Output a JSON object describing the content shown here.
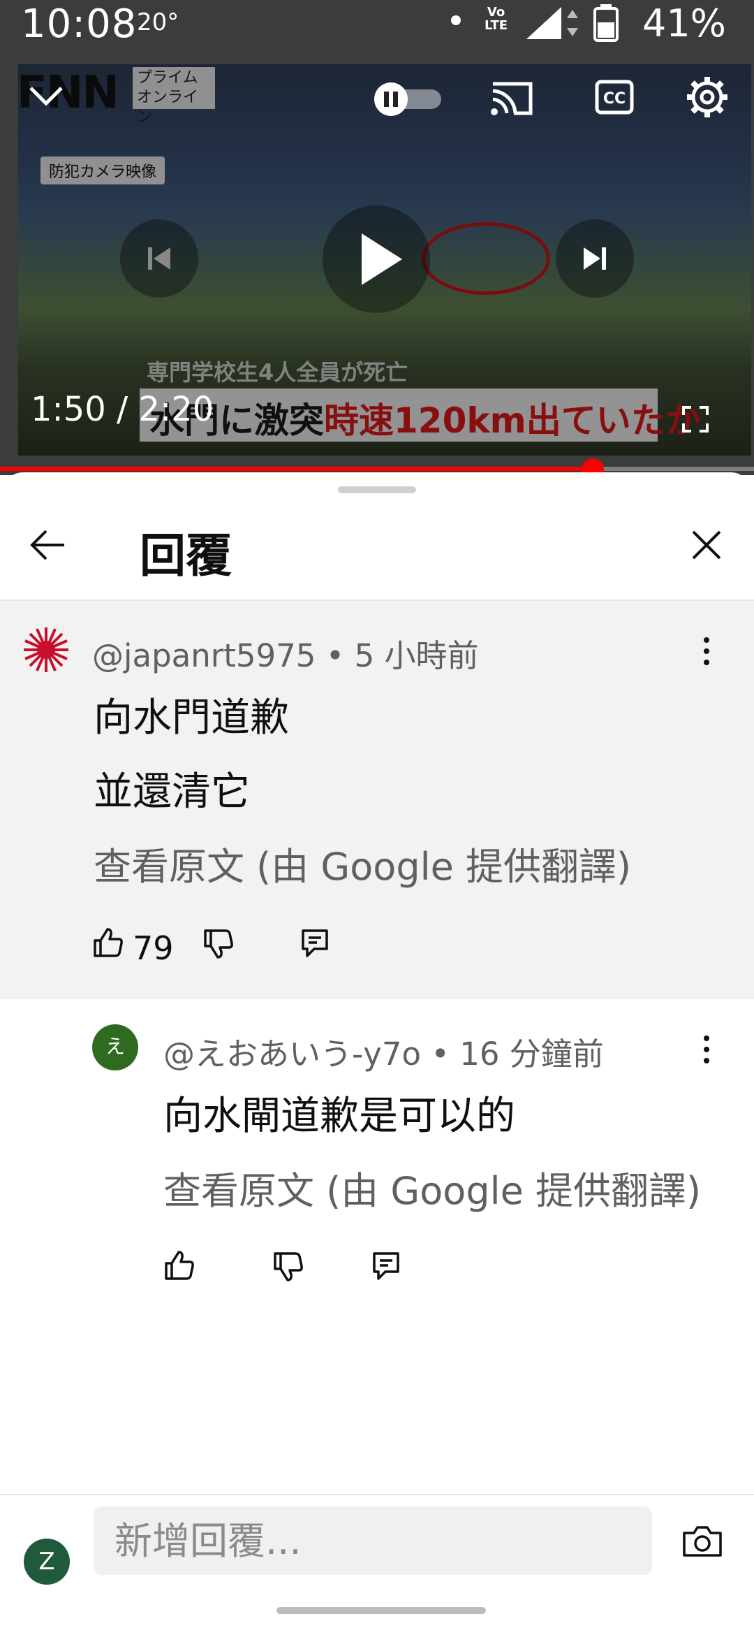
{
  "status_bar": {
    "time": "10:08",
    "temperature": "20°",
    "network_label": "Vo\nLTE",
    "battery": "41%"
  },
  "video": {
    "channel_logo": "FNN",
    "channel_sub": "プライム\nオンライン",
    "camera_label": "防犯カメラ映像",
    "caption_small": "専門学校生4人全員が死亡",
    "caption_main_black": "水門に激突",
    "caption_main_red": "時速120km出ていたか",
    "time_display": "1:50 / 2:20",
    "progress_fraction": 0.786
  },
  "sheet": {
    "title": "回覆",
    "icons": {
      "back": "arrow-left-icon",
      "close": "close-icon"
    }
  },
  "parent_comment": {
    "author": "@japanrt5975",
    "time": "5 小時前",
    "lines": [
      "向水門道歉",
      "並還清它"
    ],
    "translate_text": "查看原文 (由 Google 提供翻譯)",
    "likes": "79"
  },
  "reply": {
    "avatar_letter": "え",
    "author": "@えおあいう-y7o",
    "time": "16 分鐘前",
    "text": "向水閘道歉是可以的",
    "translate_text": "查看原文 (由 Google 提供翻譯)"
  },
  "composer": {
    "avatar_letter": "Z",
    "placeholder": "新增回覆..."
  },
  "colors": {
    "accent": "#ff0000",
    "reply_avatar": "#2e6b21",
    "user_avatar": "#1f5a3c"
  }
}
